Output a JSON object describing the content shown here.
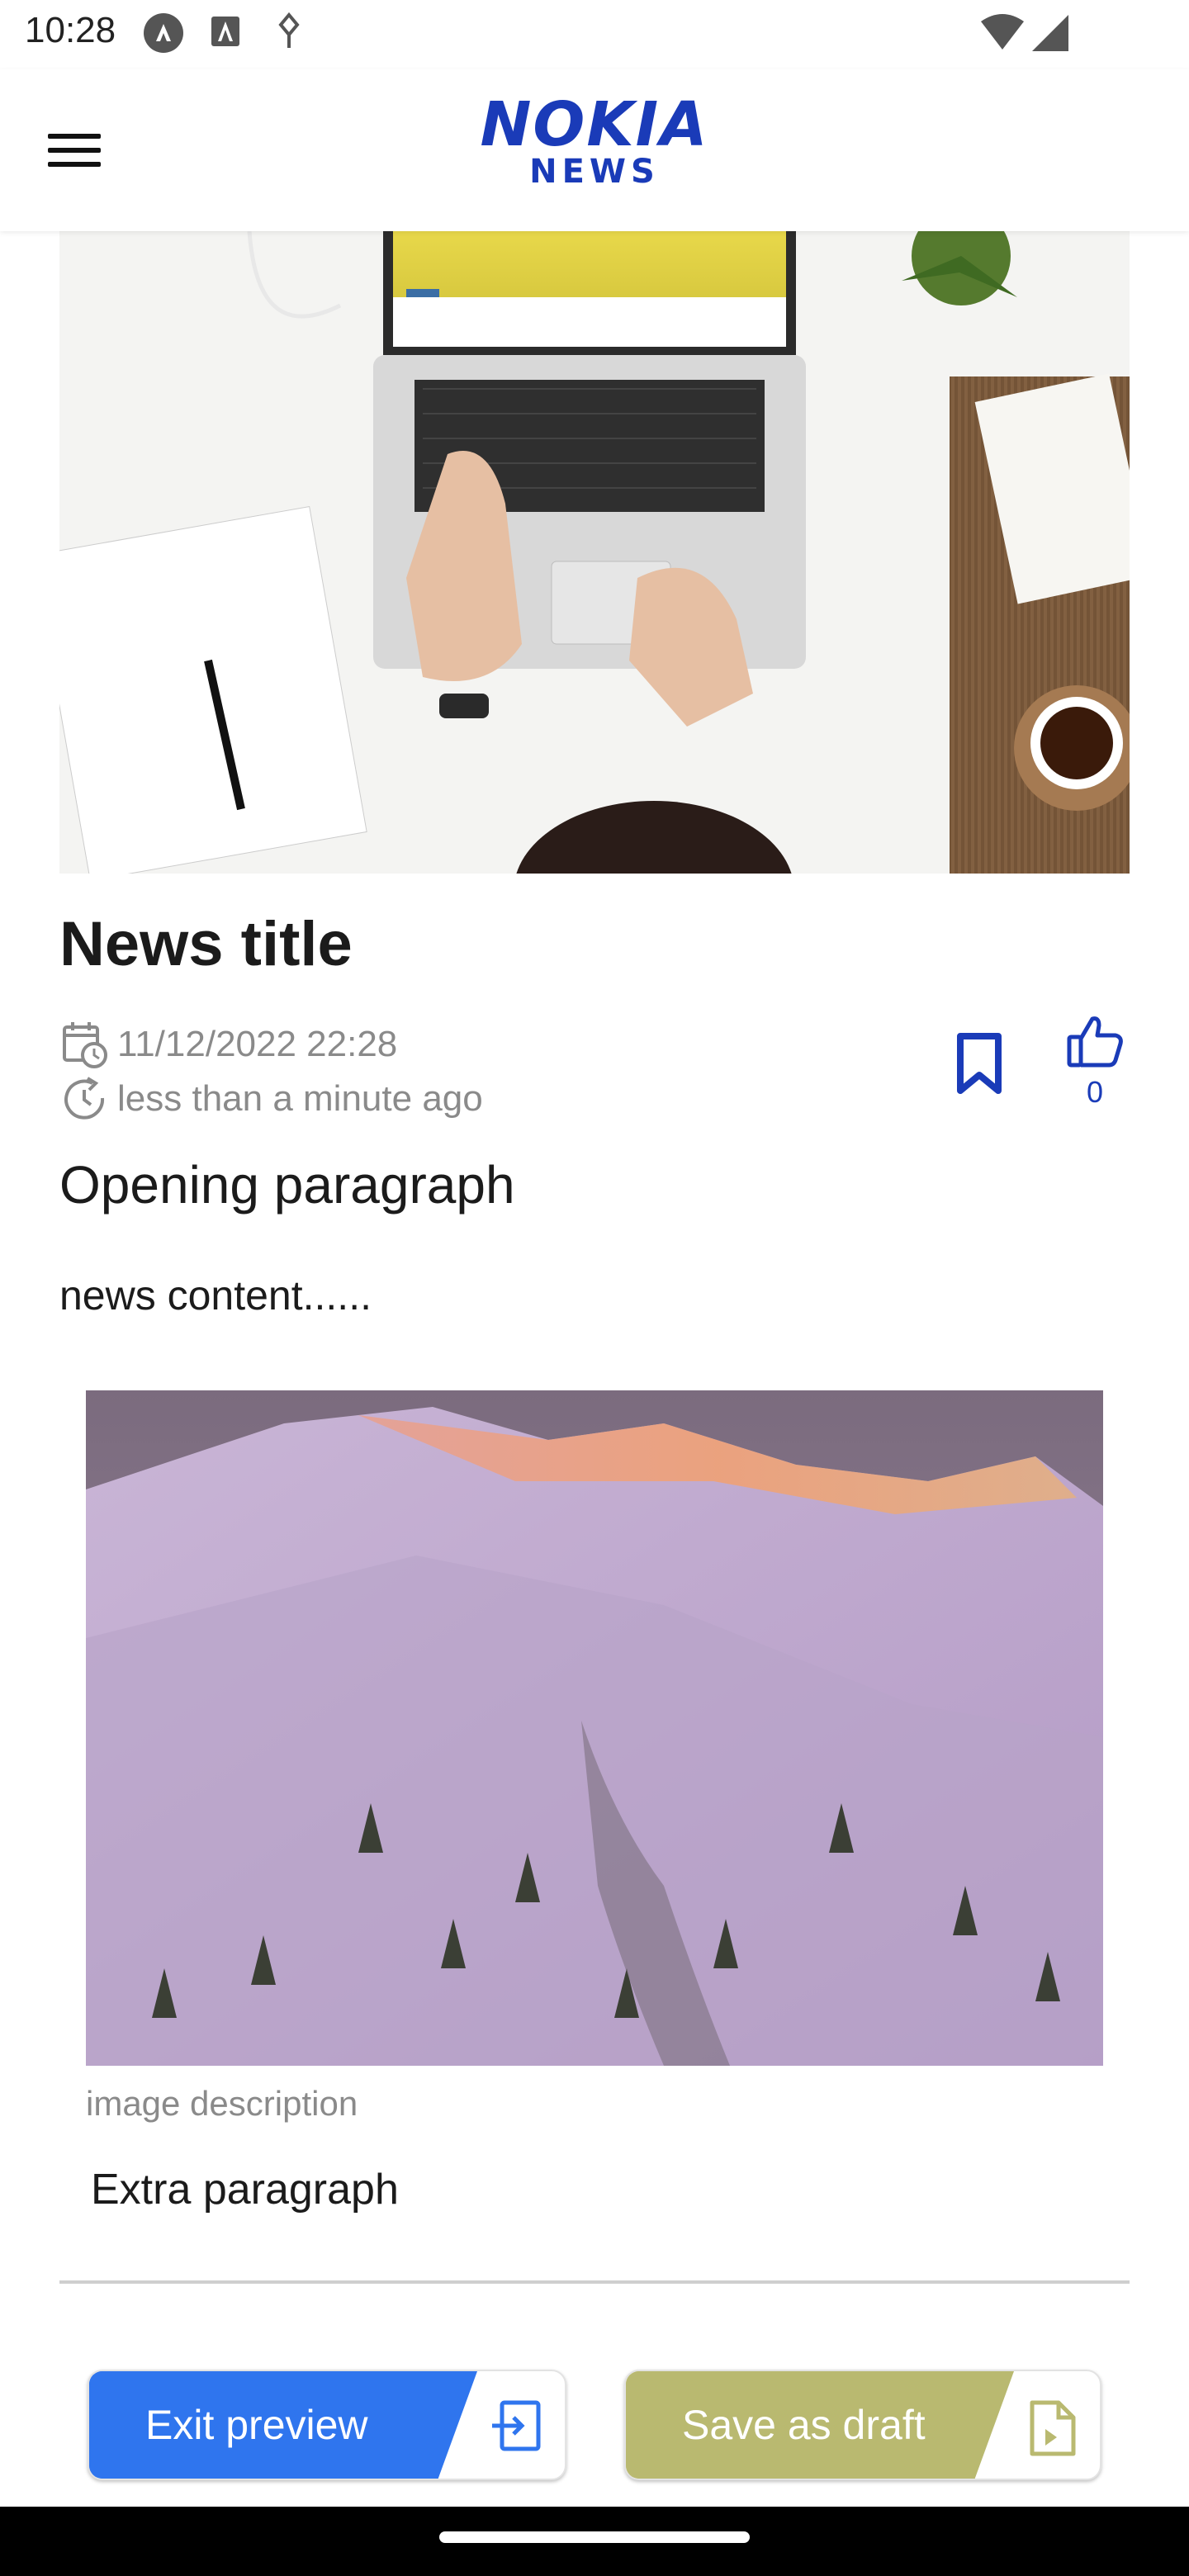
{
  "status_bar": {
    "time": "10:28",
    "icons": [
      "assistant-icon",
      "font-icon",
      "usb-debug-icon",
      "wifi-icon",
      "signal-icon"
    ]
  },
  "header": {
    "menu_icon": "hamburger-menu-icon",
    "logo_main": "NOKIA",
    "logo_sub": "NEWS",
    "brand_color": "#1a3bb8"
  },
  "article": {
    "title": "News title",
    "published": "11/12/2022 22:28",
    "relative_time": "less than a minute ago",
    "like_count": "0",
    "opening_paragraph": "Opening paragraph",
    "content": "news content......",
    "image_description": "image description",
    "extra_paragraph": "Extra paragraph"
  },
  "actions": {
    "exit_preview_label": "Exit preview",
    "exit_preview_color": "#2f75ee",
    "save_draft_label": "Save as draft",
    "save_draft_color": "#b9b970"
  }
}
